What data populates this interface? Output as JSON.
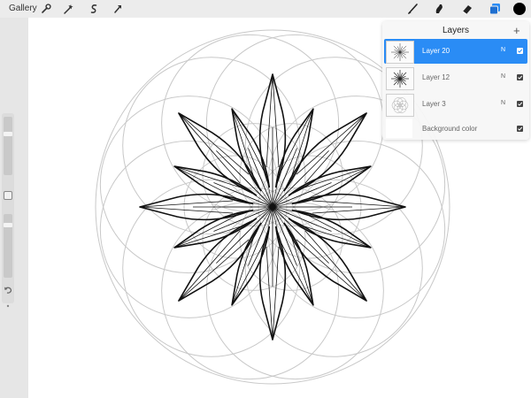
{
  "toolbar": {
    "gallery_label": "Gallery",
    "left_icons": [
      "wrench-icon",
      "magic-wand-icon",
      "selection-icon",
      "transform-arrow-icon"
    ],
    "right_icons": [
      "brush-icon",
      "smudge-icon",
      "eraser-icon",
      "layers-icon",
      "color-icon"
    ],
    "active_color": "#000000",
    "accent_color": "#2a8cf5"
  },
  "sidebar": {
    "brush_size_level": 0.72,
    "opacity_level": 0.85,
    "icons": [
      "modify-button-icon",
      "undo-icon",
      "redo-icon"
    ]
  },
  "layers_panel": {
    "title": "Layers",
    "add_icon": "plus-icon",
    "layers": [
      {
        "name": "Layer 20",
        "mode": "N",
        "visible": true,
        "selected": true
      },
      {
        "name": "Layer 12",
        "mode": "N",
        "visible": true,
        "selected": false
      },
      {
        "name": "Layer 3",
        "mode": "N",
        "visible": true,
        "selected": false
      }
    ],
    "background": {
      "name": "Background color",
      "visible": true
    }
  }
}
